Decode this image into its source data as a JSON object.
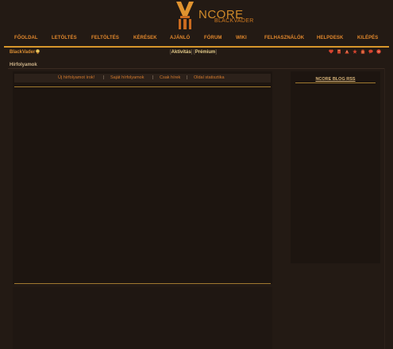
{
  "logo": {
    "main": "NCORE",
    "sub": "BLACKVADER"
  },
  "nav": {
    "items": [
      "FŐOLDAL",
      "LETÖLTÉS",
      "FELTÖLTÉS",
      "KÉRÉSEK",
      "AJÁNLÓ",
      "FÓRUM",
      "WIKI",
      "FELHASZNÁLÓK",
      "HELPDESK",
      "KILÉPÉS"
    ]
  },
  "user": {
    "name": "BlackVader",
    "activity_label": "Aktivitás",
    "premium_label": "Prémium"
  },
  "tool_icons": [
    "heart-icon",
    "book-icon",
    "warning-icon",
    "star-icon",
    "gift-icon",
    "chat-icon",
    "message-icon"
  ],
  "colors": {
    "accent": "#e1872c",
    "background": "#231a14",
    "panel": "#1d1510",
    "gold": "#d7962c"
  },
  "section": {
    "title": "Hírfolyamok"
  },
  "subnav": {
    "items": [
      "Új hírfolyamot írok!",
      "Saját hírfolyamok",
      "Csak hírek",
      "Oldal statisztika"
    ],
    "separator": "|"
  },
  "sidebar": {
    "title": "NCORE BLOG RSS"
  }
}
